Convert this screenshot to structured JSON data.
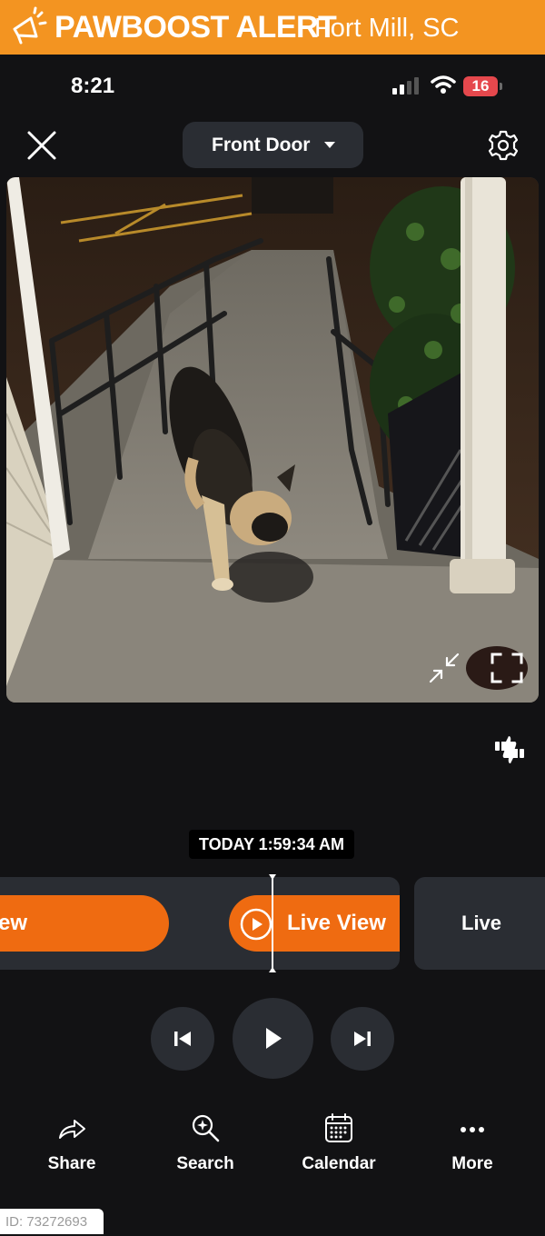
{
  "banner": {
    "brand": "PAWBOOST ALERT",
    "location": "Fort Mill, SC",
    "icon": "megaphone-icon",
    "color": "#f39421"
  },
  "status_bar": {
    "time": "8:21",
    "battery": "16",
    "battery_color": "#e5484d"
  },
  "header": {
    "camera_name": "Front Door",
    "close_icon": "close-icon",
    "settings_icon": "gear-icon"
  },
  "video": {
    "subject": "dog-on-walkway",
    "collapse_icon": "collapse-arrows-icon",
    "fullscreen_icon": "fullscreen-icon"
  },
  "feedback": {
    "icon": "thumbs-up-down-icon"
  },
  "timeline": {
    "timestamp": "TODAY 1:59:34 AM",
    "clip_left_label": "ew",
    "clip_center_label": "Live View",
    "clip_right_label": "Live",
    "accent": "#ef6b11"
  },
  "controls": {
    "prev": "skip-previous-icon",
    "play": "play-icon",
    "next": "skip-next-icon"
  },
  "toolbar": {
    "items": [
      {
        "label": "Share",
        "icon": "share-arrow-icon"
      },
      {
        "label": "Search",
        "icon": "search-sparkle-icon"
      },
      {
        "label": "Calendar",
        "icon": "calendar-icon"
      },
      {
        "label": "More",
        "icon": "more-dots-icon"
      }
    ]
  },
  "image_id": "ID: 73272693"
}
